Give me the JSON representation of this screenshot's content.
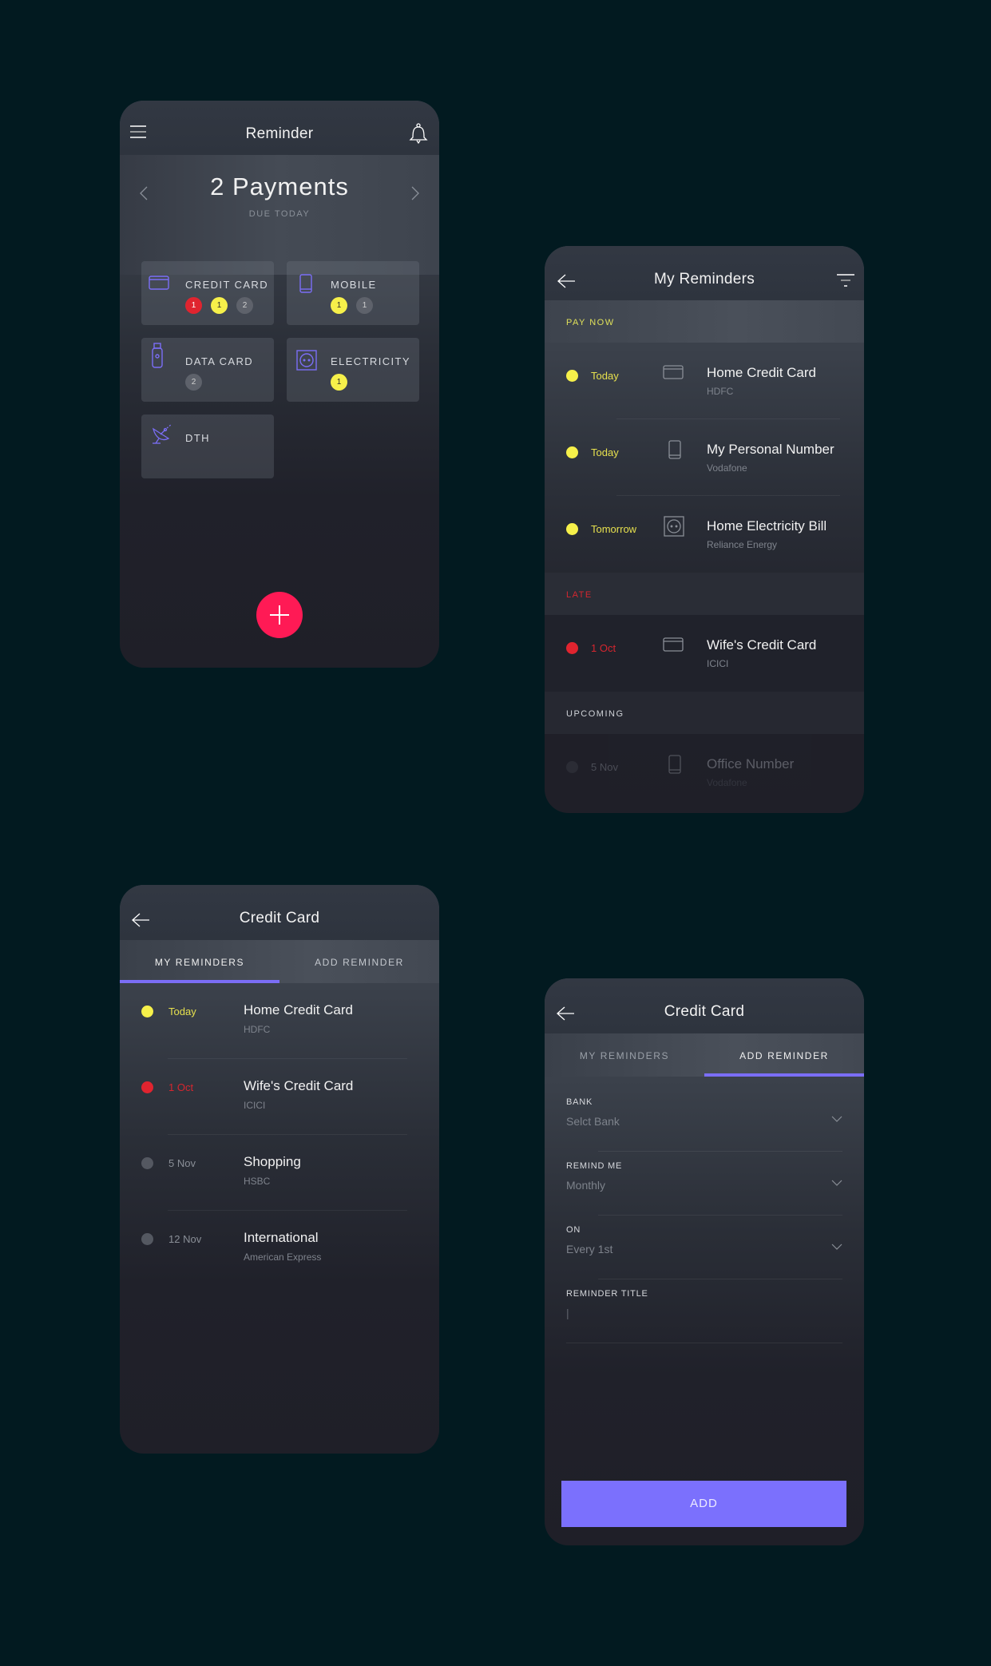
{
  "colors": {
    "background": "#021a20",
    "accent": "#7b6ef6",
    "fab": "#ff1a55",
    "late": "#e0242f",
    "today": "#f6f04a",
    "upcoming": "#5e626b",
    "icon": "#7b6ef6"
  },
  "screen1": {
    "title": "Reminder",
    "headline": "2 Payments",
    "subheadline": "DUE TODAY",
    "icons": {
      "menu": "hamburger-menu-icon",
      "bell": "bell-icon",
      "prev": "chevron-left-icon",
      "next": "chevron-right-icon",
      "fab": "plus-icon"
    },
    "categories": [
      {
        "label": "CREDIT CARD",
        "icon": "credit-card-icon",
        "badges": [
          {
            "value": "1",
            "status": "late"
          },
          {
            "value": "1",
            "status": "today"
          },
          {
            "value": "2",
            "status": "upcoming"
          }
        ]
      },
      {
        "label": "MOBILE",
        "icon": "mobile-phone-icon",
        "badges": [
          {
            "value": "1",
            "status": "today"
          },
          {
            "value": "1",
            "status": "upcoming"
          }
        ]
      },
      {
        "label": "DATA CARD",
        "icon": "usb-data-card-icon",
        "badges": [
          {
            "value": "2",
            "status": "upcoming"
          }
        ]
      },
      {
        "label": "ELECTRICITY",
        "icon": "power-socket-icon",
        "badges": [
          {
            "value": "1",
            "status": "today"
          }
        ]
      },
      {
        "label": "DTH",
        "icon": "satellite-dish-icon",
        "badges": []
      }
    ]
  },
  "screen2": {
    "title": "My Reminders",
    "sections": [
      {
        "label": "PAY NOW",
        "status": "today",
        "items": [
          {
            "date": "Today",
            "name": "Home Credit Card",
            "provider": "HDFC",
            "icon": "credit-card-icon"
          },
          {
            "date": "Today",
            "name": "My Personal Number",
            "provider": "Vodafone",
            "icon": "mobile-phone-icon"
          },
          {
            "date": "Tomorrow",
            "name": "Home Electricity Bill",
            "provider": "Reliance Energy",
            "icon": "power-socket-icon"
          }
        ]
      },
      {
        "label": "LATE",
        "status": "late",
        "items": [
          {
            "date": "1 Oct",
            "name": "Wife's Credit Card",
            "provider": "ICICI",
            "icon": "credit-card-icon"
          }
        ]
      },
      {
        "label": "UPCOMING",
        "status": "upcoming",
        "items": [
          {
            "date": "5 Nov",
            "name": "Office Number",
            "provider": "Vodafone",
            "icon": "mobile-phone-icon"
          }
        ]
      }
    ]
  },
  "screen3": {
    "title": "Credit Card",
    "tabs": [
      {
        "label": "MY REMINDERS",
        "active": true
      },
      {
        "label": "ADD REMINDER",
        "active": false
      }
    ],
    "items": [
      {
        "date": "Today",
        "name": "Home Credit Card",
        "provider": "HDFC",
        "status": "today"
      },
      {
        "date": "1 Oct",
        "name": "Wife's Credit Card",
        "provider": "ICICI",
        "status": "late"
      },
      {
        "date": "5 Nov",
        "name": "Shopping",
        "provider": "HSBC",
        "status": "upcoming"
      },
      {
        "date": "12 Nov",
        "name": "International",
        "provider": "American Express",
        "status": "upcoming"
      }
    ]
  },
  "screen4": {
    "title": "Credit Card",
    "tabs": [
      {
        "label": "MY REMINDERS",
        "active": false
      },
      {
        "label": "ADD REMINDER",
        "active": true
      }
    ],
    "fields": [
      {
        "label": "BANK",
        "value": "Selct Bank",
        "type": "select"
      },
      {
        "label": "REMIND ME",
        "value": "Monthly",
        "type": "select"
      },
      {
        "label": "ON",
        "value": "Every 1st",
        "type": "select"
      },
      {
        "label": "REMINDER TITLE",
        "value": "|",
        "type": "text"
      }
    ],
    "submit_label": "ADD"
  }
}
